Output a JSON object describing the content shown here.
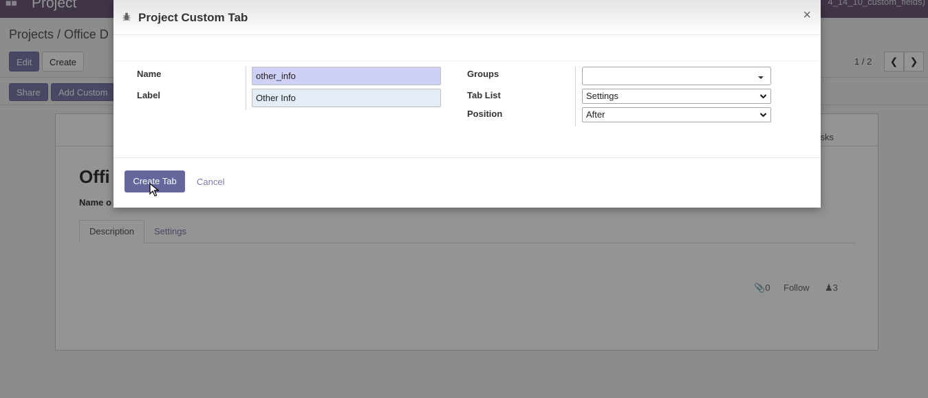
{
  "navbar": {
    "app_name": "Project",
    "db_name": "4_14_10_custom_fields)"
  },
  "breadcrumb": "Projects / Office D",
  "actions": {
    "edit": "Edit",
    "create": "Create",
    "share": "Share",
    "add_custom": "Add Custom"
  },
  "pager": {
    "value": "1 / 2"
  },
  "record": {
    "title": "Offi",
    "name_label": "Name o",
    "tasks_label": "sks",
    "tabs": [
      "Description",
      "Settings"
    ],
    "attachments_count": "0",
    "follow_label": "Follow",
    "followers_count": "3"
  },
  "modal": {
    "title": "Project Custom Tab",
    "close": "×",
    "fields": {
      "name_label": "Name",
      "name_value": "other_info",
      "label_label": "Label",
      "label_value": "Other Info",
      "groups_label": "Groups",
      "groups_value": "",
      "tab_list_label": "Tab List",
      "tab_list_value": "Settings",
      "position_label": "Position",
      "position_value": "After"
    },
    "footer": {
      "create_tab": "Create Tab",
      "cancel": "Cancel"
    }
  },
  "colors": {
    "primary": "#7c7bad",
    "navbar": "#6e5a7a"
  },
  "icons": [
    "apps-icon",
    "bug-icon",
    "close-icon",
    "chevron-left-icon",
    "chevron-right-icon",
    "paperclip-icon",
    "user-icon",
    "dropdown-caret-icon",
    "mouse-cursor-icon"
  ]
}
